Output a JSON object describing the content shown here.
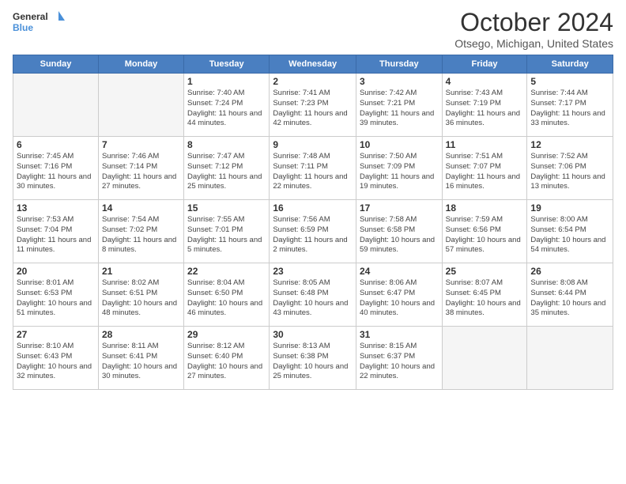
{
  "header": {
    "logo_line1": "General",
    "logo_line2": "Blue",
    "month_title": "October 2024",
    "location": "Otsego, Michigan, United States"
  },
  "days_of_week": [
    "Sunday",
    "Monday",
    "Tuesday",
    "Wednesday",
    "Thursday",
    "Friday",
    "Saturday"
  ],
  "weeks": [
    [
      {
        "day": "",
        "info": ""
      },
      {
        "day": "",
        "info": ""
      },
      {
        "day": "1",
        "info": "Sunrise: 7:40 AM\nSunset: 7:24 PM\nDaylight: 11 hours and 44 minutes."
      },
      {
        "day": "2",
        "info": "Sunrise: 7:41 AM\nSunset: 7:23 PM\nDaylight: 11 hours and 42 minutes."
      },
      {
        "day": "3",
        "info": "Sunrise: 7:42 AM\nSunset: 7:21 PM\nDaylight: 11 hours and 39 minutes."
      },
      {
        "day": "4",
        "info": "Sunrise: 7:43 AM\nSunset: 7:19 PM\nDaylight: 11 hours and 36 minutes."
      },
      {
        "day": "5",
        "info": "Sunrise: 7:44 AM\nSunset: 7:17 PM\nDaylight: 11 hours and 33 minutes."
      }
    ],
    [
      {
        "day": "6",
        "info": "Sunrise: 7:45 AM\nSunset: 7:16 PM\nDaylight: 11 hours and 30 minutes."
      },
      {
        "day": "7",
        "info": "Sunrise: 7:46 AM\nSunset: 7:14 PM\nDaylight: 11 hours and 27 minutes."
      },
      {
        "day": "8",
        "info": "Sunrise: 7:47 AM\nSunset: 7:12 PM\nDaylight: 11 hours and 25 minutes."
      },
      {
        "day": "9",
        "info": "Sunrise: 7:48 AM\nSunset: 7:11 PM\nDaylight: 11 hours and 22 minutes."
      },
      {
        "day": "10",
        "info": "Sunrise: 7:50 AM\nSunset: 7:09 PM\nDaylight: 11 hours and 19 minutes."
      },
      {
        "day": "11",
        "info": "Sunrise: 7:51 AM\nSunset: 7:07 PM\nDaylight: 11 hours and 16 minutes."
      },
      {
        "day": "12",
        "info": "Sunrise: 7:52 AM\nSunset: 7:06 PM\nDaylight: 11 hours and 13 minutes."
      }
    ],
    [
      {
        "day": "13",
        "info": "Sunrise: 7:53 AM\nSunset: 7:04 PM\nDaylight: 11 hours and 11 minutes."
      },
      {
        "day": "14",
        "info": "Sunrise: 7:54 AM\nSunset: 7:02 PM\nDaylight: 11 hours and 8 minutes."
      },
      {
        "day": "15",
        "info": "Sunrise: 7:55 AM\nSunset: 7:01 PM\nDaylight: 11 hours and 5 minutes."
      },
      {
        "day": "16",
        "info": "Sunrise: 7:56 AM\nSunset: 6:59 PM\nDaylight: 11 hours and 2 minutes."
      },
      {
        "day": "17",
        "info": "Sunrise: 7:58 AM\nSunset: 6:58 PM\nDaylight: 10 hours and 59 minutes."
      },
      {
        "day": "18",
        "info": "Sunrise: 7:59 AM\nSunset: 6:56 PM\nDaylight: 10 hours and 57 minutes."
      },
      {
        "day": "19",
        "info": "Sunrise: 8:00 AM\nSunset: 6:54 PM\nDaylight: 10 hours and 54 minutes."
      }
    ],
    [
      {
        "day": "20",
        "info": "Sunrise: 8:01 AM\nSunset: 6:53 PM\nDaylight: 10 hours and 51 minutes."
      },
      {
        "day": "21",
        "info": "Sunrise: 8:02 AM\nSunset: 6:51 PM\nDaylight: 10 hours and 48 minutes."
      },
      {
        "day": "22",
        "info": "Sunrise: 8:04 AM\nSunset: 6:50 PM\nDaylight: 10 hours and 46 minutes."
      },
      {
        "day": "23",
        "info": "Sunrise: 8:05 AM\nSunset: 6:48 PM\nDaylight: 10 hours and 43 minutes."
      },
      {
        "day": "24",
        "info": "Sunrise: 8:06 AM\nSunset: 6:47 PM\nDaylight: 10 hours and 40 minutes."
      },
      {
        "day": "25",
        "info": "Sunrise: 8:07 AM\nSunset: 6:45 PM\nDaylight: 10 hours and 38 minutes."
      },
      {
        "day": "26",
        "info": "Sunrise: 8:08 AM\nSunset: 6:44 PM\nDaylight: 10 hours and 35 minutes."
      }
    ],
    [
      {
        "day": "27",
        "info": "Sunrise: 8:10 AM\nSunset: 6:43 PM\nDaylight: 10 hours and 32 minutes."
      },
      {
        "day": "28",
        "info": "Sunrise: 8:11 AM\nSunset: 6:41 PM\nDaylight: 10 hours and 30 minutes."
      },
      {
        "day": "29",
        "info": "Sunrise: 8:12 AM\nSunset: 6:40 PM\nDaylight: 10 hours and 27 minutes."
      },
      {
        "day": "30",
        "info": "Sunrise: 8:13 AM\nSunset: 6:38 PM\nDaylight: 10 hours and 25 minutes."
      },
      {
        "day": "31",
        "info": "Sunrise: 8:15 AM\nSunset: 6:37 PM\nDaylight: 10 hours and 22 minutes."
      },
      {
        "day": "",
        "info": ""
      },
      {
        "day": "",
        "info": ""
      }
    ]
  ]
}
